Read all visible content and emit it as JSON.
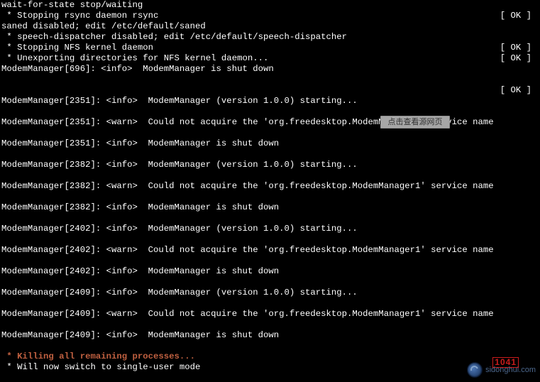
{
  "lines": [
    {
      "left": "wait-for-state stop/waiting",
      "right": ""
    },
    {
      "left": " * Stopping rsync daemon rsync",
      "right": "[ OK ]"
    },
    {
      "left": "saned disabled; edit /etc/default/saned",
      "right": ""
    },
    {
      "left": " * speech-dispatcher disabled; edit /etc/default/speech-dispatcher",
      "right": ""
    },
    {
      "left": " * Stopping NFS kernel daemon",
      "right": "[ OK ]"
    },
    {
      "left": " * Unexporting directories for NFS kernel daemon...",
      "right": "[ OK ]"
    },
    {
      "left": "ModemManager[696]: <info>  ModemManager is shut down",
      "right": ""
    },
    {
      "left": "",
      "right": ""
    },
    {
      "left": "",
      "right": "[ OK ]"
    },
    {
      "left": "ModemManager[2351]: <info>  ModemManager (version 1.0.0) starting...",
      "right": ""
    },
    {
      "left": "",
      "right": ""
    },
    {
      "left": "ModemManager[2351]: <warn>  Could not acquire the 'org.freedesktop.ModemManager1' service name",
      "right": ""
    },
    {
      "left": "",
      "right": ""
    },
    {
      "left": "ModemManager[2351]: <info>  ModemManager is shut down",
      "right": ""
    },
    {
      "left": "",
      "right": ""
    },
    {
      "left": "ModemManager[2382]: <info>  ModemManager (version 1.0.0) starting...",
      "right": ""
    },
    {
      "left": "",
      "right": ""
    },
    {
      "left": "ModemManager[2382]: <warn>  Could not acquire the 'org.freedesktop.ModemManager1' service name",
      "right": ""
    },
    {
      "left": "",
      "right": ""
    },
    {
      "left": "ModemManager[2382]: <info>  ModemManager is shut down",
      "right": ""
    },
    {
      "left": "",
      "right": ""
    },
    {
      "left": "ModemManager[2402]: <info>  ModemManager (version 1.0.0) starting...",
      "right": ""
    },
    {
      "left": "",
      "right": ""
    },
    {
      "left": "ModemManager[2402]: <warn>  Could not acquire the 'org.freedesktop.ModemManager1' service name",
      "right": ""
    },
    {
      "left": "",
      "right": ""
    },
    {
      "left": "ModemManager[2402]: <info>  ModemManager is shut down",
      "right": ""
    },
    {
      "left": "",
      "right": ""
    },
    {
      "left": "ModemManager[2409]: <info>  ModemManager (version 1.0.0) starting...",
      "right": ""
    },
    {
      "left": "",
      "right": ""
    },
    {
      "left": "ModemManager[2409]: <warn>  Could not acquire the 'org.freedesktop.ModemManager1' service name",
      "right": ""
    },
    {
      "left": "",
      "right": ""
    },
    {
      "left": "ModemManager[2409]: <info>  ModemManager is shut down",
      "right": ""
    },
    {
      "left": "",
      "right": ""
    },
    {
      "left": " * Killing all remaining processes...",
      "right": "",
      "left_class": "red"
    },
    {
      "left": " * Will now switch to single-user mode",
      "right": ""
    }
  ],
  "overlay_text": "点击查看源网页",
  "badge_text": "sidonghui.com",
  "stamp_text": "1041"
}
